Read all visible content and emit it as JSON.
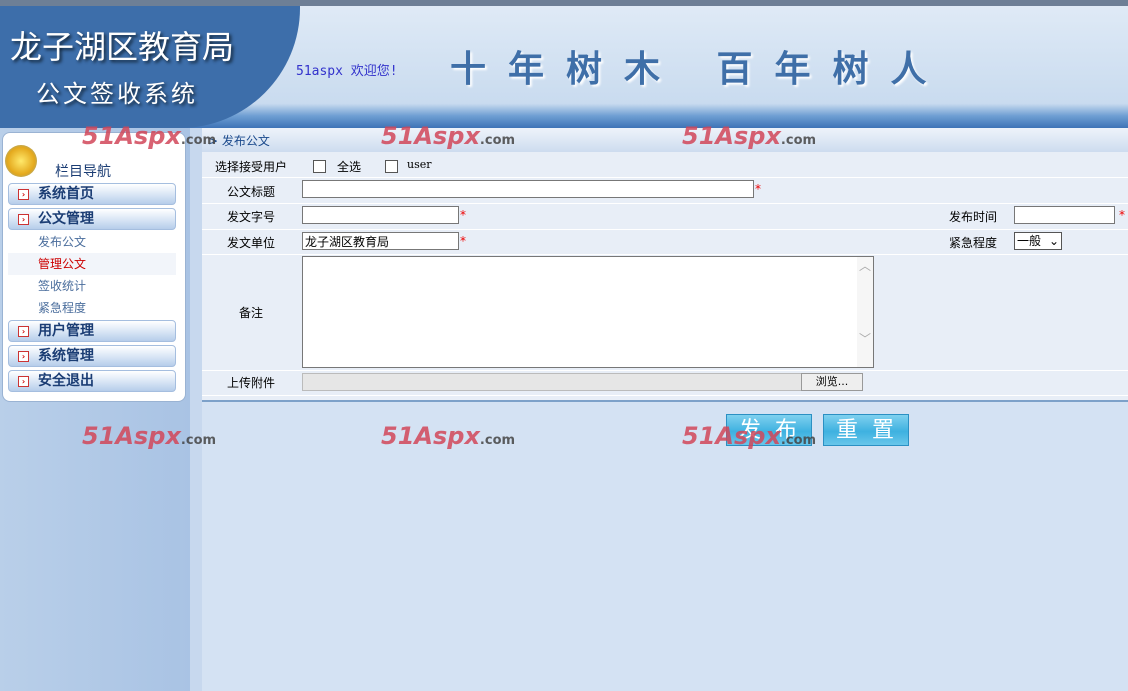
{
  "header": {
    "org": "龙子湖区教育局",
    "system": "公文签收系统",
    "welcome": "51aspx 欢迎您!",
    "slogan": "十年树木 百年树人"
  },
  "sidebar": {
    "title": "栏目导航",
    "items": [
      {
        "label": "系统首页"
      },
      {
        "label": "公文管理",
        "sub": [
          "发布公文",
          "管理公文",
          "签收统计",
          "紧急程度"
        ]
      },
      {
        "label": "用户管理"
      },
      {
        "label": "系统管理"
      },
      {
        "label": "安全退出"
      }
    ],
    "active_sub": "管理公文"
  },
  "breadcrumb": "> 发布公文",
  "form": {
    "recipients_label": "选择接受用户",
    "select_all": "全选",
    "user": "user",
    "title_label": "公文标题",
    "title_value": "",
    "docno_label": "发文字号",
    "docno_value": "",
    "date_label": "发布时间",
    "date_value": "",
    "unit_label": "发文单位",
    "unit_value": "龙子湖区教育局",
    "urgency_label": "紧急程度",
    "urgency_value": "一般",
    "note_label": "备注",
    "note_value": "",
    "attach_label": "上传附件",
    "browse": "浏览...",
    "required": "*"
  },
  "buttons": {
    "publish": "发布",
    "reset": "重置"
  },
  "watermark": {
    "brand": "51Aspx",
    "suffix": ".com"
  }
}
